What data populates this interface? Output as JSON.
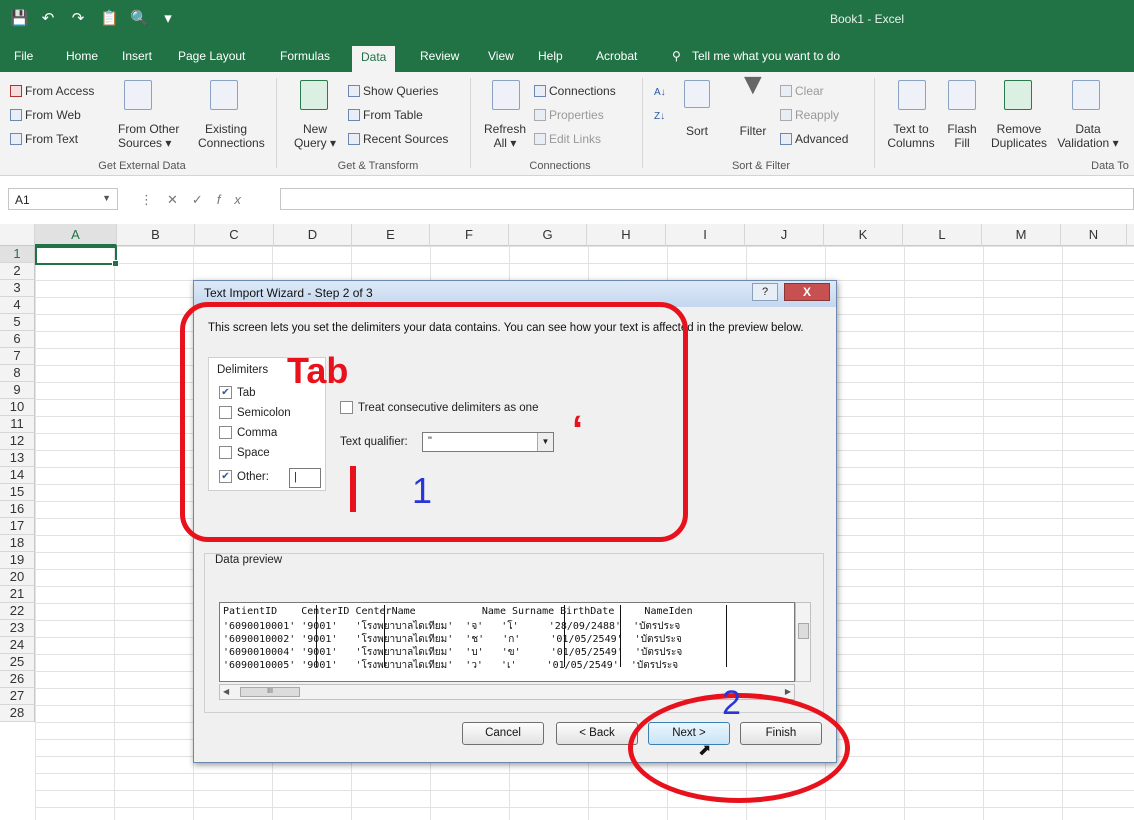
{
  "app": {
    "book_title": "Book1 - Excel",
    "accent": "#217346"
  },
  "tabs": [
    "File",
    "Home",
    "Insert",
    "Page Layout",
    "Formulas",
    "Data",
    "Review",
    "View",
    "Help",
    "Acrobat"
  ],
  "tell_me": "Tell me what you want to do",
  "ribbon": {
    "from_access": "From Access",
    "from_web": "From Web",
    "from_text": "From Text",
    "from_other": "From Other",
    "sources": "Sources",
    "existing": "Existing",
    "connections_btn": "Connections",
    "group_external": "Get External Data",
    "new_query": "New",
    "query": "Query",
    "show_queries": "Show Queries",
    "from_table": "From Table",
    "recent_sources": "Recent Sources",
    "group_transform": "Get & Transform",
    "refresh": "Refresh",
    "refresh_all": "All",
    "connections": "Connections",
    "properties": "Properties",
    "edit_links": "Edit Links",
    "group_connections": "Connections",
    "sort": "Sort",
    "filter": "Filter",
    "clear": "Clear",
    "reapply": "Reapply",
    "advanced": "Advanced",
    "group_sort": "Sort & Filter",
    "text_to": "Text to",
    "columns": "Columns",
    "flash": "Flash",
    "fill": "Fill",
    "remove": "Remove",
    "duplicates": "Duplicates",
    "data": "Data",
    "validation": "Validation",
    "group_tools": "Data To"
  },
  "formula_bar": {
    "name_box": "A1",
    "fx": "fx"
  },
  "columns": [
    "A",
    "B",
    "C",
    "D",
    "E",
    "F",
    "G",
    "H",
    "I",
    "J",
    "K",
    "L",
    "M",
    "N"
  ],
  "rows": [
    "1",
    "2",
    "3",
    "4",
    "5",
    "6",
    "7",
    "8",
    "9",
    "10",
    "11",
    "12",
    "13",
    "14",
    "15",
    "16",
    "17",
    "18",
    "19",
    "20",
    "21",
    "22",
    "23",
    "24",
    "25",
    "26",
    "27",
    "28"
  ],
  "dialog": {
    "title": "Text Import Wizard - Step 2 of 3",
    "help": "?",
    "close": "X",
    "description": "This screen lets you set the delimiters your data contains.  You can see how your text is affected in the preview below.",
    "delimiters_legend": "Delimiters",
    "delimiters": [
      {
        "label": "Tab",
        "checked": true
      },
      {
        "label": "Semicolon",
        "checked": false
      },
      {
        "label": "Comma",
        "checked": false
      },
      {
        "label": "Space",
        "checked": false
      },
      {
        "label": "Other:",
        "checked": true
      }
    ],
    "other_value": "|",
    "consecutive_label": "Treat consecutive delimiters as one",
    "qualifier_label": "Text qualifier:",
    "qualifier_value": "\"",
    "preview_label": "Data preview",
    "preview_rows": [
      "PatientID    CenterID CenterName           Name Surname BirthDate     NameIden",
      "'6090010001' '9001'   'โรงพยาบาลไดเทียม'  'จ'   'โ'     '28/09/2488'  'บัตรประจ",
      "'6090010002' '9001'   'โรงพยาบาลไดเทียม'  'ช'   'ก'     '01/05/2549'  'บัตรประจ",
      "'6090010004' '9001'   'โรงพยาบาลไดเทียม'  'บ'   'ข'     '01/05/2549'  'บัตรประจ",
      "'6090010005' '9001'   'โรงพยาบาลไดเทียม'  'ว'   'เ'     '01/05/2549'  'บัตรประจ"
    ],
    "hscroll_thumb": "III",
    "buttons": {
      "cancel": "Cancel",
      "back": "< Back",
      "next": "Next >",
      "finish": "Finish"
    }
  },
  "annotations": {
    "tab_label": "Tab",
    "step_one": "1",
    "step_two": "2",
    "quote_mark": "‘",
    "color_red": "#e8121d",
    "color_blue": "#2a35d6"
  }
}
